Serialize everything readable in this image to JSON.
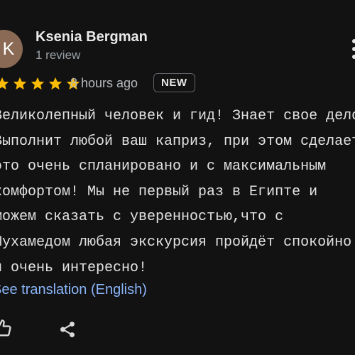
{
  "review": {
    "author": {
      "avatar_initial": "K",
      "avatar_color": "#8a6a55",
      "name": "Ksenia Bergman",
      "review_count": "1 review"
    },
    "rating": 5,
    "max_rating": 5,
    "star_color": "#fbbc04",
    "time_ago": "8 hours ago",
    "badge": "NEW",
    "text_lines": [
      "Великолепный человек и гид! Знает свое дело!",
      "Выполнит любой ваш каприз, при этом сделает",
      "это очень спланировано и с максимальным",
      "комфортом! Мы не первый раз в Египте и",
      "можем сказать с уверенностью,что с",
      "Мухамедом любая экскурсия пройдёт спокойно",
      "и очень интересно!"
    ],
    "translation_link": "See translation (English)",
    "link_color": "#8ab4f8"
  },
  "icons": {
    "more": "more-vert-icon",
    "star": "star-icon",
    "like": "thumb-up-icon",
    "share": "share-icon"
  }
}
